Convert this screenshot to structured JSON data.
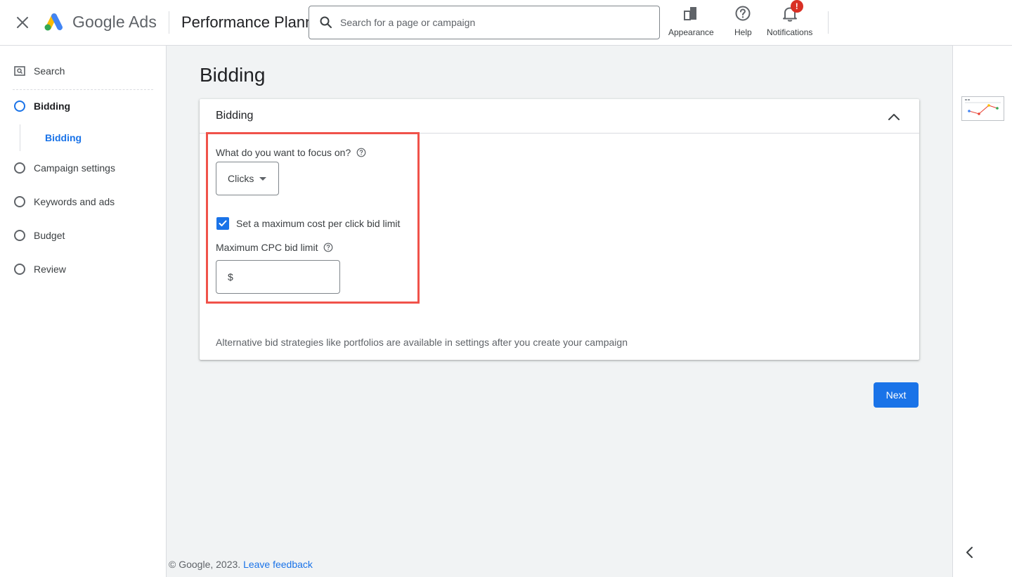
{
  "header": {
    "brand": "Google Ads",
    "product_title": "Performance Planner",
    "search_placeholder": "Search for a page or campaign",
    "actions": {
      "appearance": "Appearance",
      "help": "Help",
      "notifications": "Notifications",
      "notifications_badge": "!"
    }
  },
  "sidebar": {
    "search": "Search",
    "items": [
      {
        "label": "Bidding",
        "active": true
      },
      {
        "label": "Campaign settings"
      },
      {
        "label": "Keywords and ads"
      },
      {
        "label": "Budget"
      },
      {
        "label": "Review"
      }
    ],
    "sub_item": "Bidding"
  },
  "main": {
    "page_title": "Bidding",
    "card": {
      "title": "Bidding",
      "focus_label": "What do you want to focus on?",
      "focus_value": "Clicks",
      "checkbox_label": "Set a maximum cost per click bid limit",
      "checkbox_checked": true,
      "cpc_label": "Maximum CPC bid limit",
      "currency_symbol": "$",
      "cpc_value": "",
      "footnote": "Alternative bid strategies like portfolios are available in settings after you create your campaign"
    },
    "next_label": "Next"
  },
  "footer": {
    "copyright": "© Google, 2023.",
    "feedback_link": "Leave feedback"
  },
  "colors": {
    "accent": "#1a73e8",
    "highlight": "#f0524a",
    "badge": "#d93025",
    "page_bg": "#f1f3f4"
  },
  "icons": [
    "close-icon",
    "google-ads-logo",
    "search-icon",
    "appearance-icon",
    "help-icon",
    "bell-icon",
    "search-nav-icon",
    "help-circle-icon",
    "chevron-up-icon",
    "check-icon",
    "chevron-left-icon"
  ]
}
